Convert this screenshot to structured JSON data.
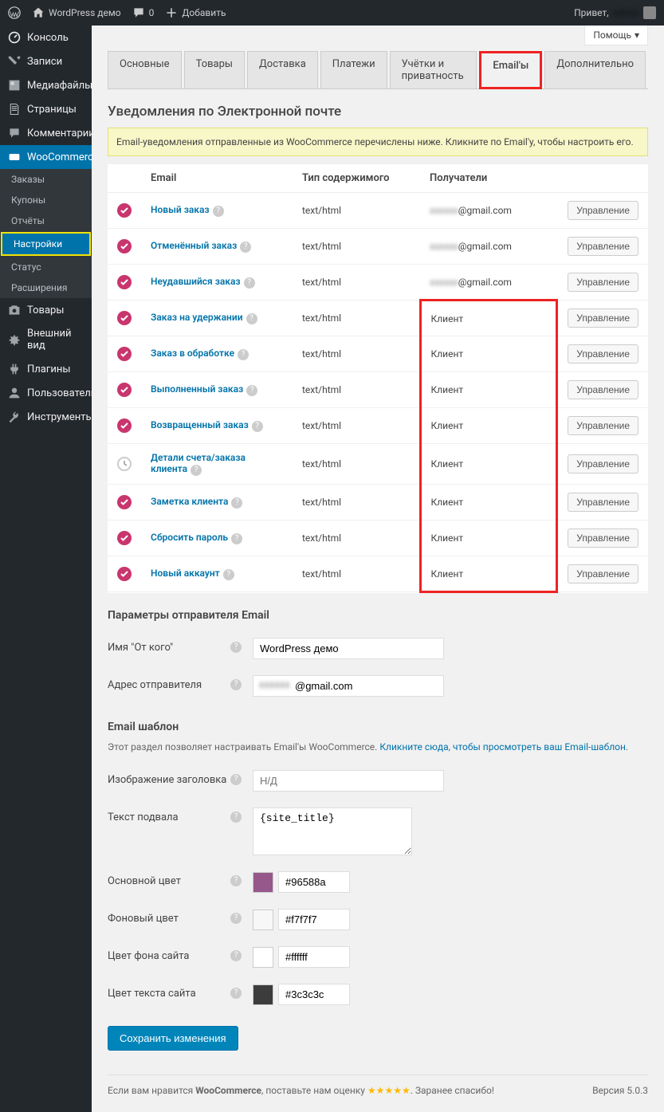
{
  "adminbar": {
    "site": "WordPress демо",
    "comments": "0",
    "add": "Добавить",
    "greeting": "Привет,",
    "user": "admin"
  },
  "help": "Помощь",
  "sidebar": {
    "items": [
      {
        "label": "Консоль"
      },
      {
        "label": "Записи"
      },
      {
        "label": "Медиафайлы"
      },
      {
        "label": "Страницы"
      },
      {
        "label": "Комментарии"
      },
      {
        "label": "WooCommerce"
      },
      {
        "label": "Товары"
      },
      {
        "label": "Внешний вид"
      },
      {
        "label": "Плагины"
      },
      {
        "label": "Пользователи"
      },
      {
        "label": "Инструменты"
      }
    ],
    "submenu": [
      {
        "label": "Заказы"
      },
      {
        "label": "Купоны"
      },
      {
        "label": "Отчёты"
      },
      {
        "label": "Настройки"
      },
      {
        "label": "Статус"
      },
      {
        "label": "Расширения"
      }
    ]
  },
  "tabs": [
    {
      "label": "Основные"
    },
    {
      "label": "Товары"
    },
    {
      "label": "Доставка"
    },
    {
      "label": "Платежи"
    },
    {
      "label": "Учётки и приватность"
    },
    {
      "label": "Email'ы"
    },
    {
      "label": "Дополнительно"
    }
  ],
  "page": {
    "title": "Уведомления по Электронной почте",
    "notice": "Email-уведомления отправленные из WooCommerce перечислены ниже. Кликните по Email'у, чтобы настроить его."
  },
  "table": {
    "headers": {
      "email": "Email",
      "type": "Тип содержимого",
      "recipients": "Получатели"
    },
    "manage": "Управление",
    "rows": [
      {
        "name": "Новый заказ",
        "type": "text/html",
        "recipient": "@gmail.com",
        "blur": true,
        "on": true
      },
      {
        "name": "Отменённый заказ",
        "type": "text/html",
        "recipient": "@gmail.com",
        "blur": true,
        "on": true
      },
      {
        "name": "Неудавшийся заказ",
        "type": "text/html",
        "recipient": "@gmail.com",
        "blur": true,
        "on": true
      },
      {
        "name": "Заказ на удержании",
        "type": "text/html",
        "recipient": "Клиент",
        "on": true
      },
      {
        "name": "Заказ в обработке",
        "type": "text/html",
        "recipient": "Клиент",
        "on": true
      },
      {
        "name": "Выполненный заказ",
        "type": "text/html",
        "recipient": "Клиент",
        "on": true
      },
      {
        "name": "Возвращенный заказ",
        "type": "text/html",
        "recipient": "Клиент",
        "on": true
      },
      {
        "name": "Детали счета/заказа клиента",
        "type": "text/html",
        "recipient": "Клиент",
        "on": false
      },
      {
        "name": "Заметка клиента",
        "type": "text/html",
        "recipient": "Клиент",
        "on": true
      },
      {
        "name": "Сбросить пароль",
        "type": "text/html",
        "recipient": "Клиент",
        "on": true
      },
      {
        "name": "Новый аккаунт",
        "type": "text/html",
        "recipient": "Клиент",
        "on": true
      }
    ]
  },
  "sender": {
    "heading": "Параметры отправителя Email",
    "from_name_label": "Имя \"От кого\"",
    "from_name_value": "WordPress демо",
    "from_addr_label": "Адрес отправителя",
    "from_addr_value": "@gmail.com"
  },
  "template": {
    "heading": "Email шаблон",
    "desc_pre": "Этот раздел позволяет настраивать Email'ы WooCommerce. ",
    "desc_link": "Кликните сюда, чтобы просмотреть ваш Email-шаблон",
    "header_img_label": "Изображение заголовка",
    "header_img_value": "Н/Д",
    "footer_text_label": "Текст подвала",
    "footer_text_value": "{site_title}",
    "base_color_label": "Основной цвет",
    "base_color_value": "#96588a",
    "bg_color_label": "Фоновый цвет",
    "bg_color_value": "#f7f7f7",
    "body_bg_label": "Цвет фона сайта",
    "body_bg_value": "#ffffff",
    "text_color_label": "Цвет текста сайта",
    "text_color_value": "#3c3c3c"
  },
  "save": "Сохранить изменения",
  "footer": {
    "text_pre": "Если вам нравится ",
    "brand": "WooCommerce",
    "text_mid": ", поставьте нам оценку ",
    "stars": "★★★★★",
    "text_post": ". Заранее спасибо!",
    "version": "Версия 5.0.3"
  }
}
